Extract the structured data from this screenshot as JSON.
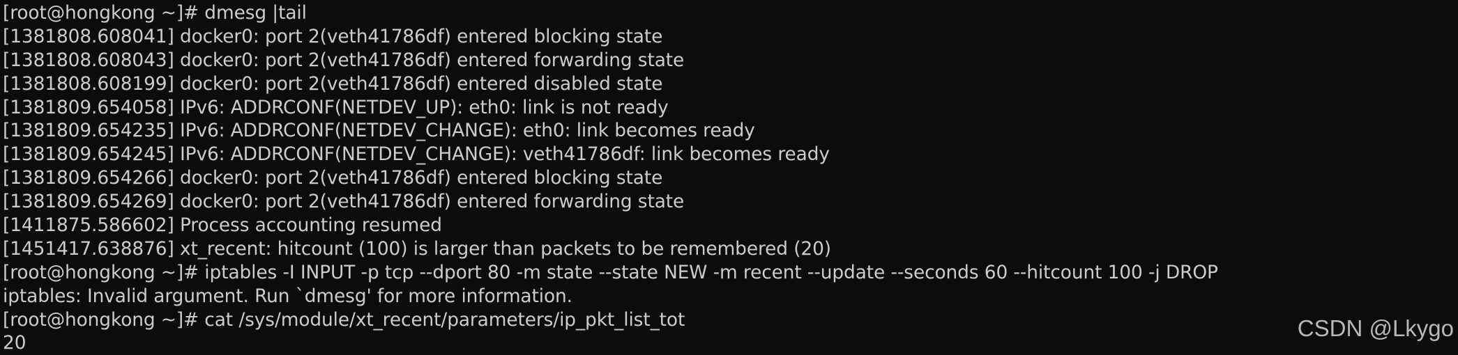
{
  "terminal": {
    "lines": [
      "[root@hongkong ~]# dmesg |tail",
      "[1381808.608041] docker0: port 2(veth41786df) entered blocking state",
      "[1381808.608043] docker0: port 2(veth41786df) entered forwarding state",
      "[1381808.608199] docker0: port 2(veth41786df) entered disabled state",
      "[1381809.654058] IPv6: ADDRCONF(NETDEV_UP): eth0: link is not ready",
      "[1381809.654235] IPv6: ADDRCONF(NETDEV_CHANGE): eth0: link becomes ready",
      "[1381809.654245] IPv6: ADDRCONF(NETDEV_CHANGE): veth41786df: link becomes ready",
      "[1381809.654266] docker0: port 2(veth41786df) entered blocking state",
      "[1381809.654269] docker0: port 2(veth41786df) entered forwarding state",
      "[1411875.586602] Process accounting resumed",
      "[1451417.638876] xt_recent: hitcount (100) is larger than packets to be remembered (20)",
      "[root@hongkong ~]# iptables -I INPUT -p tcp --dport 80 -m state --state NEW -m recent --update --seconds 60 --hitcount 100 -j DROP",
      "iptables: Invalid argument. Run `dmesg' for more information.",
      "[root@hongkong ~]# cat /sys/module/xt_recent/parameters/ip_pkt_list_tot",
      "20"
    ],
    "background_color": "#0c0c0c",
    "text_color": "#cccccc"
  },
  "watermark": {
    "text": "CSDN @Lkygo"
  }
}
